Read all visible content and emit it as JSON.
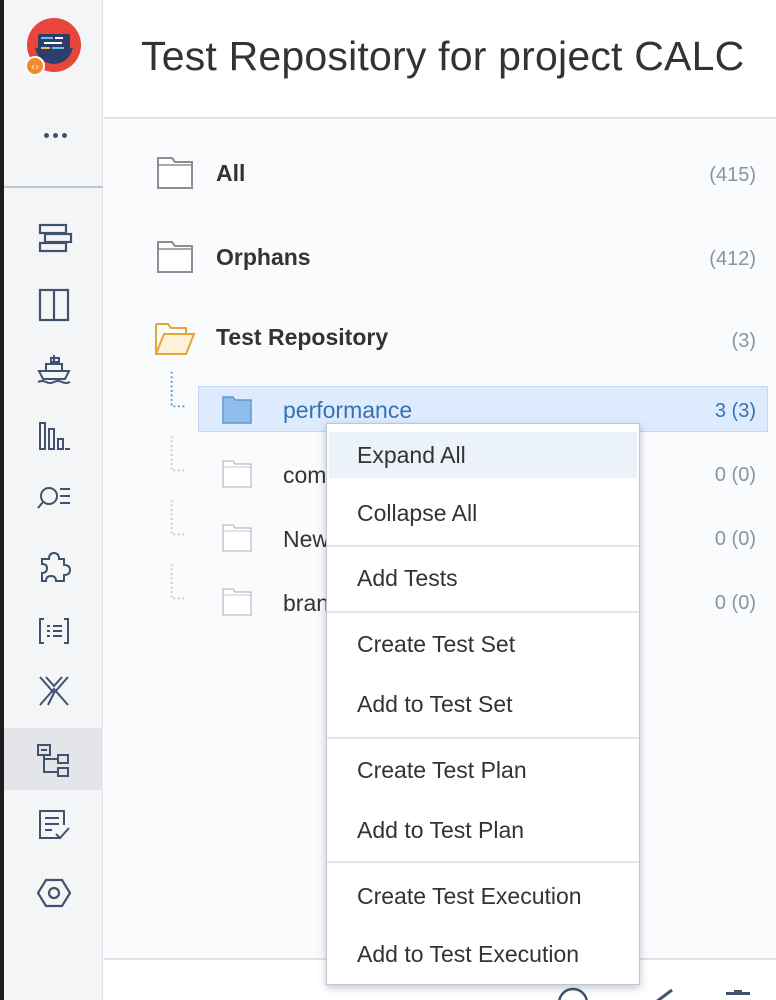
{
  "header": {
    "title": "Test Repository for project CALC"
  },
  "sidebar": {
    "more_label": "More",
    "items": [
      {
        "icon": "backlog-icon"
      },
      {
        "icon": "board-icon"
      },
      {
        "icon": "releases-icon"
      },
      {
        "icon": "reports-icon"
      },
      {
        "icon": "issues-search-icon"
      },
      {
        "icon": "add-ons-icon"
      },
      {
        "icon": "code-icon"
      },
      {
        "icon": "xray-icon"
      },
      {
        "icon": "test-repository-icon",
        "active": true
      },
      {
        "icon": "test-plan-icon"
      },
      {
        "icon": "settings-icon"
      }
    ]
  },
  "tree": {
    "all": {
      "label": "All",
      "count": "(415)"
    },
    "orphans": {
      "label": "Orphans",
      "count": "(412)"
    },
    "repository": {
      "label": "Test Repository",
      "count": "(3)"
    },
    "folders": [
      {
        "label": "performance",
        "count": "3 (3)",
        "selected": true
      },
      {
        "label": "com",
        "count": "0 (0)"
      },
      {
        "label": "New",
        "count": "0 (0)"
      },
      {
        "label": "bran",
        "count": "0 (0)"
      }
    ]
  },
  "context_menu": {
    "items": [
      "Expand All",
      "Collapse All",
      "Add Tests",
      "Create Test Set",
      "Add to Test Set",
      "Create Test Plan",
      "Add to Test Plan",
      "Create Test Execution",
      "Add to Test Execution"
    ]
  },
  "colors": {
    "accent": "#3572b0",
    "selected_bg": "#deebff",
    "folder_open": "#f0b84b",
    "folder_selected": "#7eb1e4"
  }
}
